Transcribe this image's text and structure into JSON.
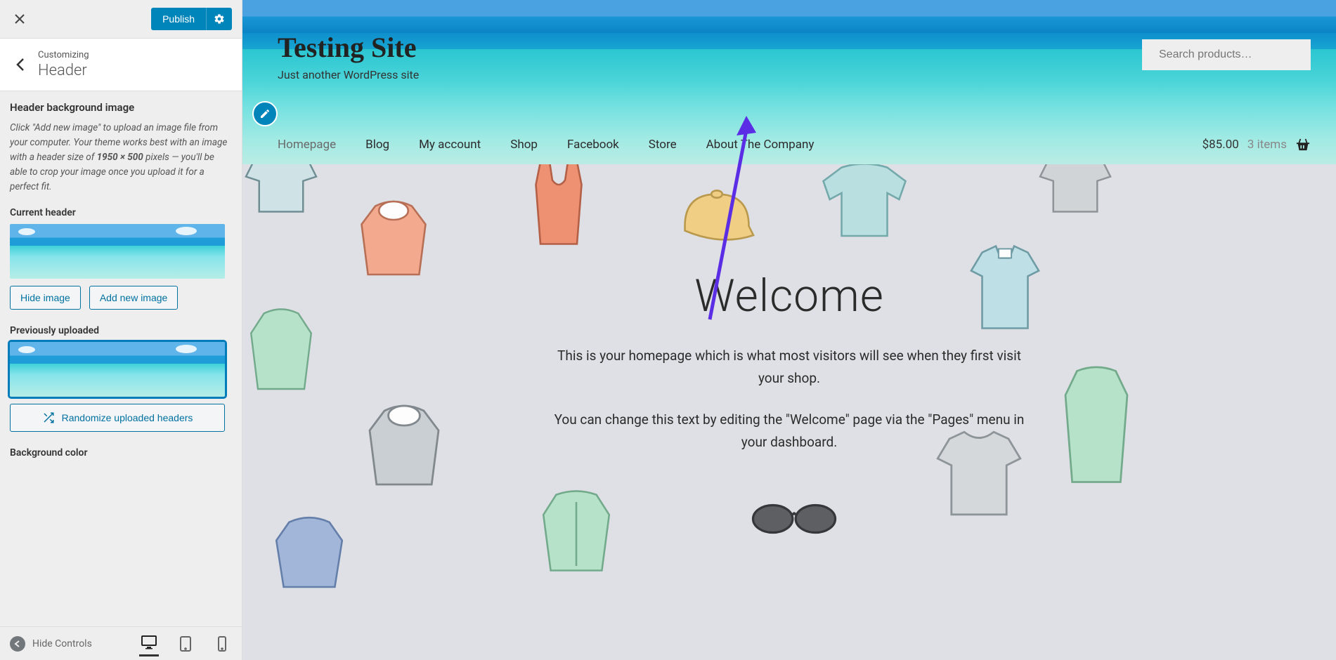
{
  "sidebar": {
    "publish_label": "Publish",
    "customizing_label": "Customizing",
    "section_title": "Header",
    "heading_bgimg": "Header background image",
    "help_prefix": "Click \"Add new image\" to upload an image file from your computer. Your theme works best with an image with a header size of ",
    "help_size": "1950 × 500",
    "help_suffix": " pixels — you'll be able to crop your image once you upload it for a perfect fit.",
    "current_header_label": "Current header",
    "hide_image_label": "Hide image",
    "add_new_image_label": "Add new image",
    "previously_uploaded_label": "Previously uploaded",
    "randomize_label": "Randomize uploaded headers",
    "background_color_label": "Background color",
    "hide_controls_label": "Hide Controls"
  },
  "site": {
    "title": "Testing Site",
    "tagline": "Just another WordPress site",
    "search_placeholder": "Search products…",
    "nav": {
      "homepage": "Homepage",
      "blog": "Blog",
      "my_account": "My account",
      "shop": "Shop",
      "facebook": "Facebook",
      "store": "Store",
      "about": "About The Company"
    },
    "cart": {
      "amount": "$85.00",
      "items": "3 items"
    },
    "welcome": {
      "heading": "Welcome",
      "p1": "This is your homepage which is what most visitors will see when they first visit your shop.",
      "p2": "You can change this text by editing the \"Welcome\" page via the \"Pages\" menu in your dashboard."
    }
  }
}
